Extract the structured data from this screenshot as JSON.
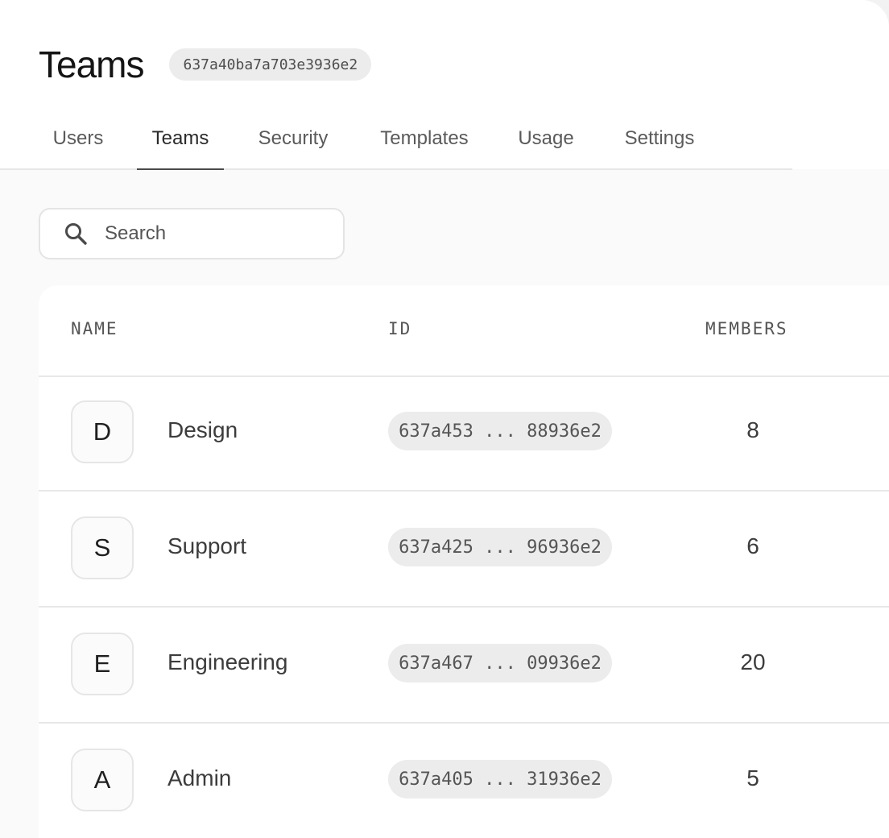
{
  "header": {
    "title": "Teams",
    "id_badge": "637a40ba7a703e3936e2"
  },
  "tabs": [
    {
      "label": "Users",
      "active": false
    },
    {
      "label": "Teams",
      "active": true
    },
    {
      "label": "Security",
      "active": false
    },
    {
      "label": "Templates",
      "active": false
    },
    {
      "label": "Usage",
      "active": false
    },
    {
      "label": "Settings",
      "active": false
    }
  ],
  "search": {
    "placeholder": "Search",
    "value": "",
    "icon": "search-icon"
  },
  "table": {
    "columns": [
      "NAME",
      "ID",
      "MEMBERS"
    ],
    "rows": [
      {
        "initial": "D",
        "name": "Design",
        "id": "637a453 ... 88936e2",
        "members": "8"
      },
      {
        "initial": "S",
        "name": "Support",
        "id": "637a425 ... 96936e2",
        "members": "6"
      },
      {
        "initial": "E",
        "name": "Engineering",
        "id": "637a467 ... 09936e2",
        "members": "20"
      },
      {
        "initial": "A",
        "name": "Admin",
        "id": "637a405 ... 31936e2",
        "members": "5"
      }
    ]
  },
  "colors": {
    "background": "#fafafa",
    "surface": "#ffffff",
    "chip": "#ececec",
    "border": "#e6e6e6",
    "text_primary": "#141414",
    "text_secondary": "#5a5a5a"
  }
}
